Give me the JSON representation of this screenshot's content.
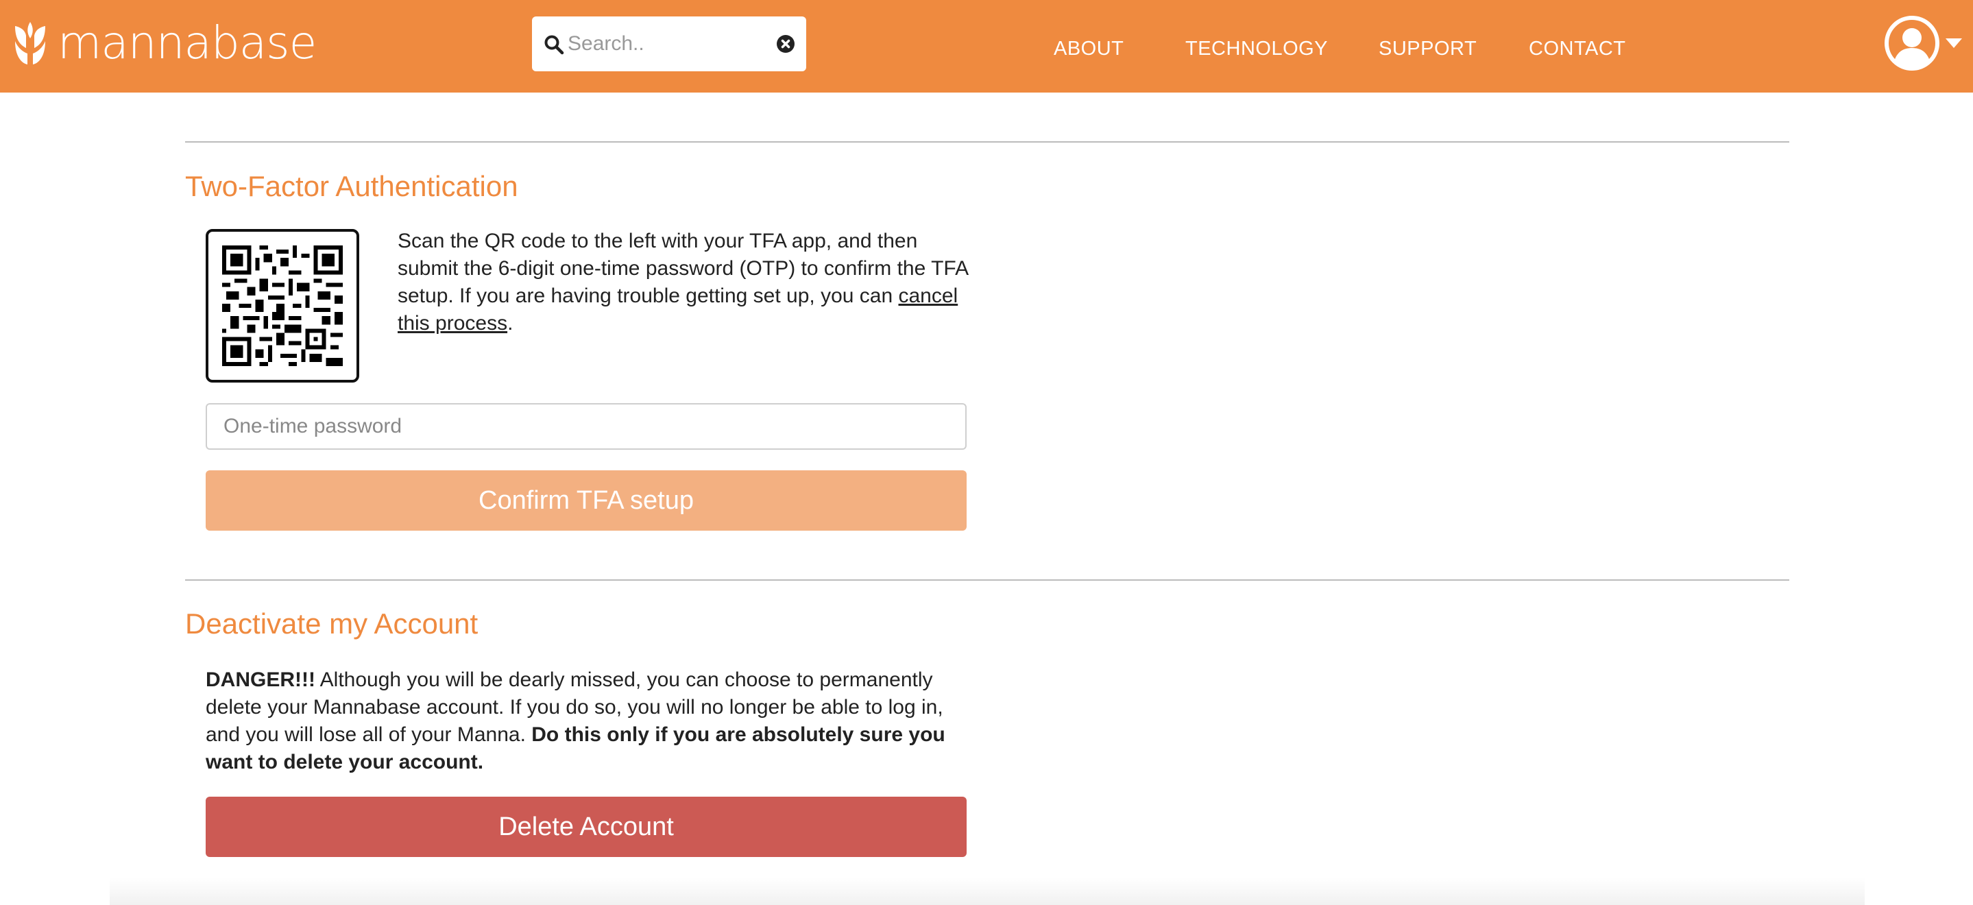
{
  "header": {
    "brand": "mannabase",
    "search": {
      "placeholder": "Search..",
      "value": ""
    },
    "nav": [
      "ABOUT",
      "TECHNOLOGY",
      "SUPPORT",
      "CONTACT"
    ],
    "colors": {
      "brand": "#ef8a3f"
    },
    "icons": {
      "logo": "mannabase-leaf-logo",
      "search": "search-icon",
      "clear": "clear-icon",
      "avatar": "user-avatar-icon",
      "menu": "caret-down-icon"
    }
  },
  "tfa": {
    "title": "Two-Factor Authentication",
    "description": "Scan the QR code to the left with your TFA app, and then submit the 6-digit one-time password (OTP) to confirm the TFA setup. If you are having trouble getting set up, you can ",
    "cancel_link": "cancel this process",
    "period": ".",
    "otp_placeholder": "One-time password",
    "confirm_label": "Confirm TFA setup",
    "confirm_color": "#f3b081"
  },
  "deactivate": {
    "title": "Deactivate my Account",
    "danger_label": "DANGER!!!",
    "text": " Although you will be dearly missed, you can choose to permanently delete your Mannabase account. If you do so, you will no longer be able to log in, and you will lose all of your Manna. ",
    "warning": "Do this only if you are absolutely sure you want to delete your account.",
    "delete_label": "Delete Account",
    "delete_color": "#cc5a54"
  }
}
